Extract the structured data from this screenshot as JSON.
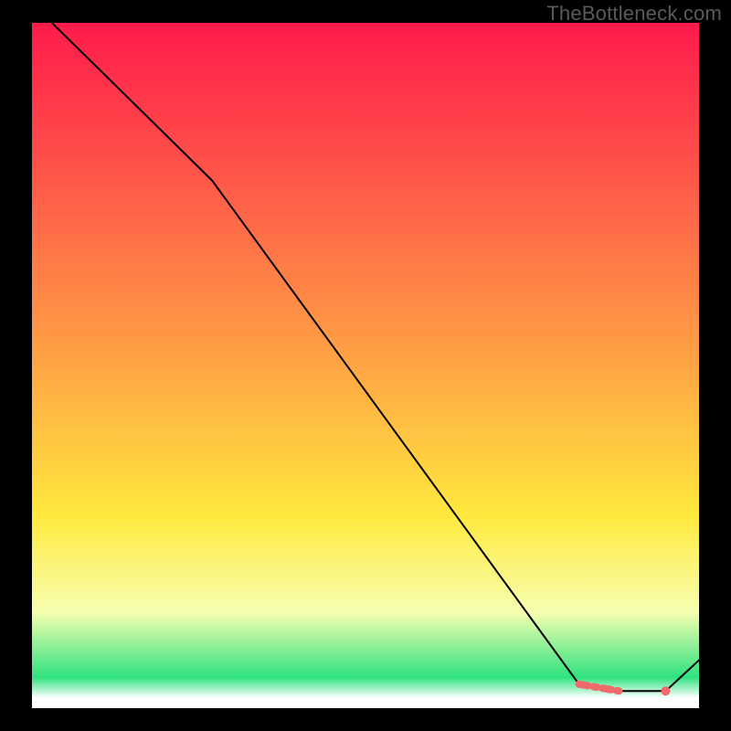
{
  "watermark": "TheBottleneck.com",
  "colors": {
    "bg": "#000000",
    "watermark": "#5a5a5a",
    "line": "#000000",
    "marker_fill": "#f06a6a",
    "marker_stroke": "#f06a6a",
    "grad_top": "#ff1b4b",
    "grad_mid_red": "#ff4a4a",
    "grad_orange": "#ffa544",
    "grad_yellow": "#ffe93e",
    "grad_pale": "#f7ffb0",
    "grad_green": "#2fe27f",
    "grad_bottom_white": "#ffffff"
  },
  "chart_data": {
    "type": "line",
    "title": "",
    "xlabel": "",
    "ylabel": "",
    "xlim": [
      0,
      100
    ],
    "ylim": [
      0,
      100
    ],
    "x": [
      3,
      27,
      82,
      88,
      95,
      100
    ],
    "y": [
      100,
      77,
      3.5,
      2.5,
      2.5,
      7
    ],
    "highlight_segments": [
      {
        "x": [
          82,
          88
        ],
        "y": [
          3.5,
          2.5
        ]
      }
    ],
    "highlight_points": [
      {
        "x": 95,
        "y": 2.5
      }
    ],
    "gradient_stops": [
      {
        "offset": 0.0,
        "color": "#ff1b4b"
      },
      {
        "offset": 0.18,
        "color": "#ff4a4a"
      },
      {
        "offset": 0.5,
        "color": "#ffa544"
      },
      {
        "offset": 0.72,
        "color": "#ffe93e"
      },
      {
        "offset": 0.86,
        "color": "#f7ffb0"
      },
      {
        "offset": 0.955,
        "color": "#2fe27f"
      },
      {
        "offset": 0.985,
        "color": "#ffffff"
      },
      {
        "offset": 1.0,
        "color": "#ffffff"
      }
    ]
  }
}
